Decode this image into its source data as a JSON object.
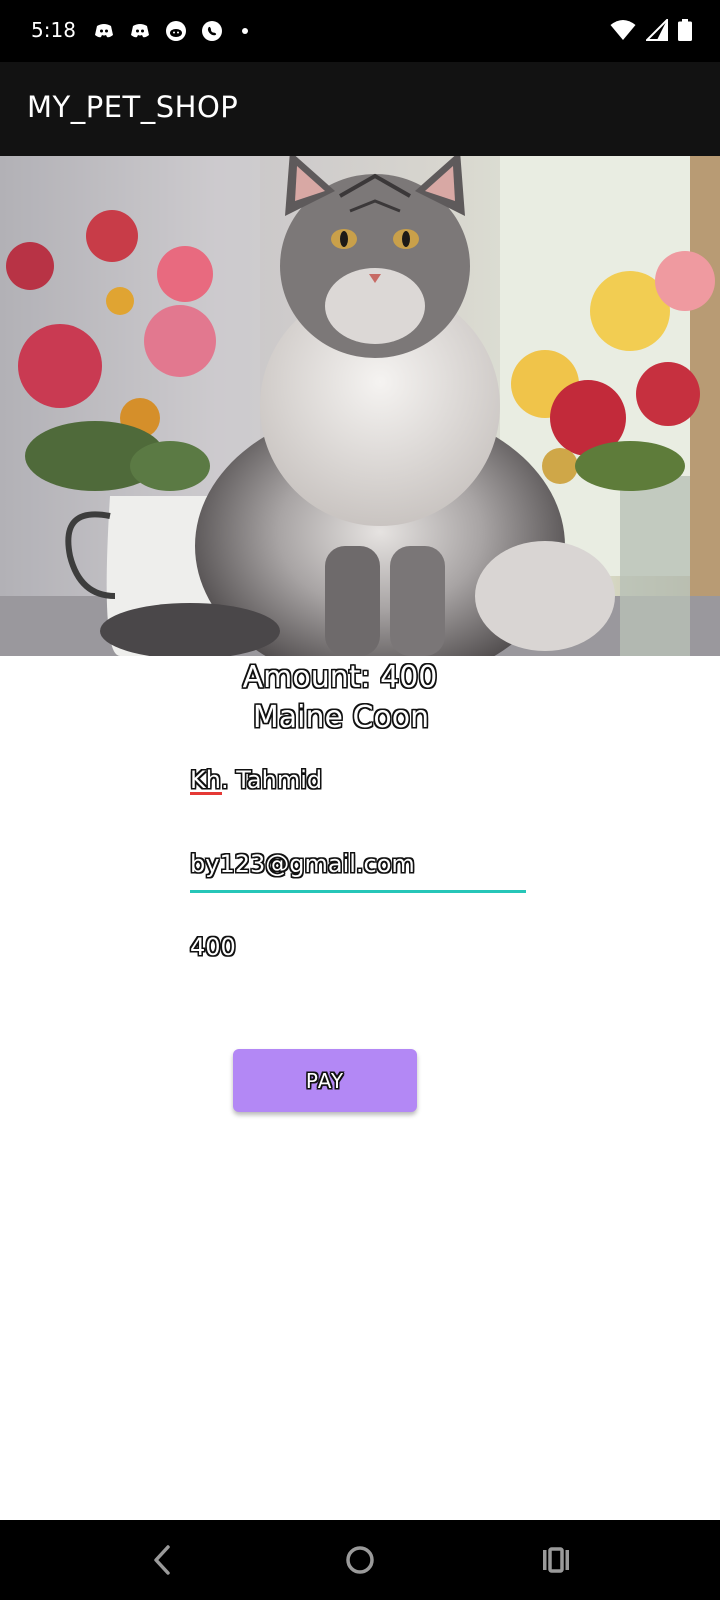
{
  "status_bar": {
    "time": "5:18",
    "notification_icons": [
      "discord-icon",
      "discord-icon",
      "reddit-icon",
      "whatsapp-icon",
      "dot"
    ],
    "system_icons": [
      "wifi-icon",
      "signal-icon",
      "battery-icon"
    ]
  },
  "app_bar": {
    "title": "MY_PET_SHOP"
  },
  "hero_image": {
    "subject": "maine-coon-cat-photo"
  },
  "product": {
    "amount_label": "Amount: 400",
    "pet_name": "Maine Coon"
  },
  "form": {
    "name_value": "Kh. Tahmid",
    "email_value": "by123@gmail.com",
    "amount_value": "400"
  },
  "actions": {
    "pay_label": "PAY"
  },
  "colors": {
    "accent_button": "#b388f5",
    "focus_underline": "#26c6b8",
    "spellcheck_underline": "#e53935",
    "app_bar": "#121212"
  },
  "nav_bar": {
    "buttons": [
      "back-icon",
      "home-icon",
      "recents-icon"
    ]
  }
}
